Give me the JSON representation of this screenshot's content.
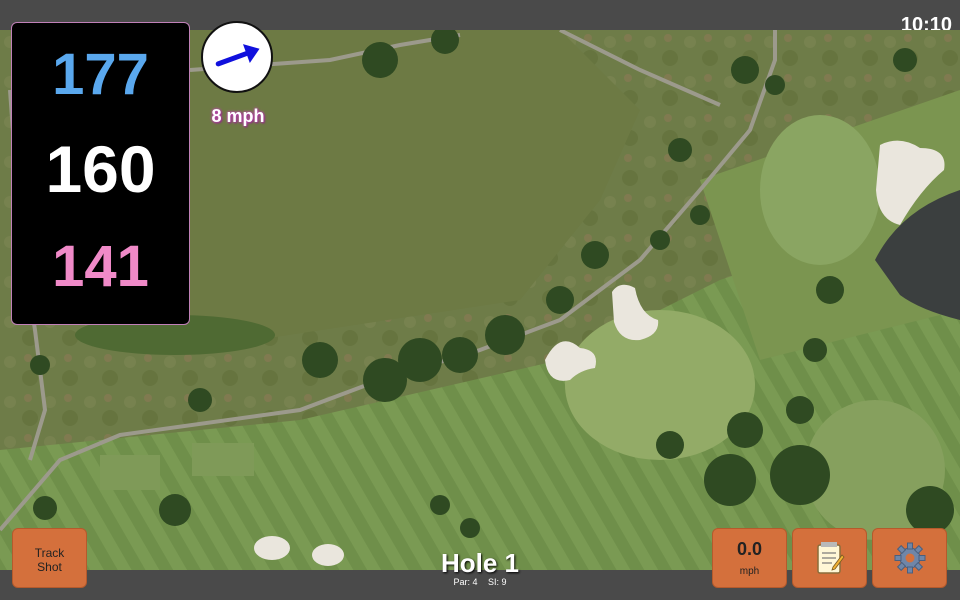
{
  "status": {
    "time": "10:10"
  },
  "distances": {
    "back": "177",
    "middle": "160",
    "front": "141"
  },
  "wind": {
    "speed": "8 mph",
    "direction_icon": "arrow-icon",
    "arrow_color": "#1010dd"
  },
  "buttons": {
    "track_shot": "Track\nShot",
    "speed_value": "0.0",
    "speed_unit": "mph",
    "notes_icon": "notepad-icon",
    "settings_icon": "gear-icon"
  },
  "hole": {
    "title": "Hole 1",
    "par": "Par: 4",
    "si": "SI: 9"
  },
  "colors": {
    "back": "#5aa8ee",
    "middle": "#ffffff",
    "front": "#f08ac8",
    "button": "#d4703c"
  }
}
